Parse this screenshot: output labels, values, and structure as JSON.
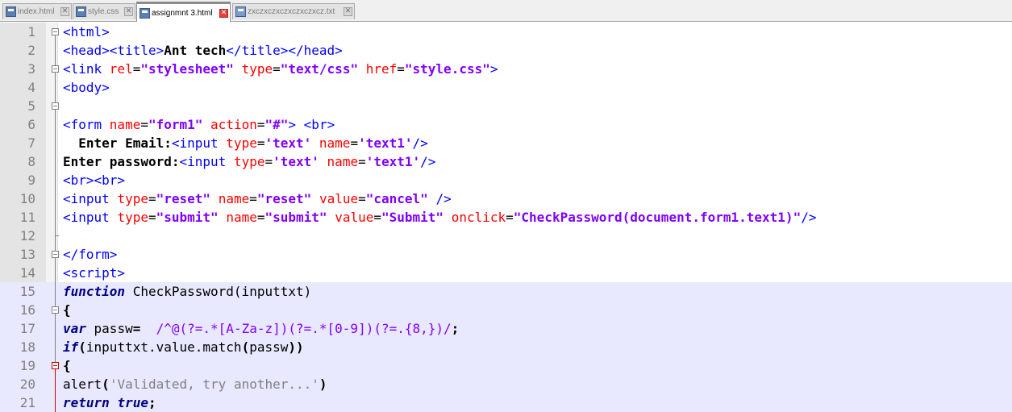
{
  "tabs": [
    {
      "label": "index.html",
      "icon": "html-file-icon",
      "active": false
    },
    {
      "label": "style.css",
      "icon": "css-file-icon",
      "active": false
    },
    {
      "label": "assignmnt 3.html",
      "icon": "html-file-icon",
      "active": true
    },
    {
      "label": "zxczxczxczxczxczxcz.txt",
      "icon": "txt-file-icon",
      "active": false
    }
  ],
  "close_glyph": "✕",
  "colors": {
    "tag": "#0000ff",
    "attribute": "#ff0000",
    "attribute_value": "#8000ff",
    "keyword": "#000080",
    "string": "#808080",
    "line_highlight": "#e8e8ff",
    "active_tab_accent": "#f5a623"
  },
  "lines": [
    {
      "num": "1",
      "hl": false,
      "tokens": [
        {
          "c": "t",
          "x": "<html>"
        }
      ]
    },
    {
      "num": "2",
      "hl": false,
      "tokens": [
        {
          "c": "t",
          "x": "<head><title>"
        },
        {
          "c": "b",
          "x": "Ant tech"
        },
        {
          "c": "t",
          "x": "</title></head>"
        }
      ]
    },
    {
      "num": "3",
      "hl": false,
      "tokens": [
        {
          "c": "t",
          "x": "<link "
        },
        {
          "c": "a",
          "x": "rel"
        },
        {
          "c": "",
          "x": "="
        },
        {
          "c": "v",
          "x": "\"stylesheet\""
        },
        {
          "c": "",
          "x": " "
        },
        {
          "c": "a",
          "x": "type"
        },
        {
          "c": "",
          "x": "="
        },
        {
          "c": "v",
          "x": "\"text/css\""
        },
        {
          "c": "",
          "x": " "
        },
        {
          "c": "a",
          "x": "href"
        },
        {
          "c": "",
          "x": "="
        },
        {
          "c": "v",
          "x": "\"style.css\""
        },
        {
          "c": "t",
          "x": ">"
        }
      ]
    },
    {
      "num": "4",
      "hl": false,
      "tokens": [
        {
          "c": "t",
          "x": "<body>"
        }
      ]
    },
    {
      "num": "5",
      "hl": false,
      "tokens": []
    },
    {
      "num": "6",
      "hl": false,
      "tokens": [
        {
          "c": "t",
          "x": "<form "
        },
        {
          "c": "a",
          "x": "name"
        },
        {
          "c": "",
          "x": "="
        },
        {
          "c": "v",
          "x": "\"form1\""
        },
        {
          "c": "",
          "x": " "
        },
        {
          "c": "a",
          "x": "action"
        },
        {
          "c": "",
          "x": "="
        },
        {
          "c": "v",
          "x": "\"#\""
        },
        {
          "c": "t",
          "x": ">"
        },
        {
          "c": "",
          "x": " "
        },
        {
          "c": "t",
          "x": "<br>"
        }
      ]
    },
    {
      "num": "7",
      "hl": false,
      "tokens": [
        {
          "c": "b",
          "x": "  Enter Email:"
        },
        {
          "c": "t",
          "x": "<input "
        },
        {
          "c": "a",
          "x": "type"
        },
        {
          "c": "",
          "x": "="
        },
        {
          "c": "v",
          "x": "'text'"
        },
        {
          "c": "",
          "x": " "
        },
        {
          "c": "a",
          "x": "name"
        },
        {
          "c": "",
          "x": "="
        },
        {
          "c": "v",
          "x": "'text1'"
        },
        {
          "c": "t",
          "x": "/>"
        }
      ]
    },
    {
      "num": "8",
      "hl": false,
      "tokens": [
        {
          "c": "b",
          "x": "Enter password:"
        },
        {
          "c": "t",
          "x": "<input "
        },
        {
          "c": "a",
          "x": "type"
        },
        {
          "c": "",
          "x": "="
        },
        {
          "c": "v",
          "x": "'text'"
        },
        {
          "c": "",
          "x": " "
        },
        {
          "c": "a",
          "x": "name"
        },
        {
          "c": "",
          "x": "="
        },
        {
          "c": "v",
          "x": "'text1'"
        },
        {
          "c": "t",
          "x": "/>"
        }
      ]
    },
    {
      "num": "9",
      "hl": false,
      "tokens": [
        {
          "c": "t",
          "x": "<br><br>"
        }
      ]
    },
    {
      "num": "10",
      "hl": false,
      "tokens": [
        {
          "c": "t",
          "x": "<input "
        },
        {
          "c": "a",
          "x": "type"
        },
        {
          "c": "",
          "x": "="
        },
        {
          "c": "v",
          "x": "\"reset\""
        },
        {
          "c": "",
          "x": " "
        },
        {
          "c": "a",
          "x": "name"
        },
        {
          "c": "",
          "x": "="
        },
        {
          "c": "v",
          "x": "\"reset\""
        },
        {
          "c": "",
          "x": " "
        },
        {
          "c": "a",
          "x": "value"
        },
        {
          "c": "",
          "x": "="
        },
        {
          "c": "v",
          "x": "\"cancel\""
        },
        {
          "c": "",
          "x": " "
        },
        {
          "c": "t",
          "x": "/>"
        }
      ]
    },
    {
      "num": "11",
      "hl": false,
      "tokens": [
        {
          "c": "t",
          "x": "<input "
        },
        {
          "c": "a",
          "x": "type"
        },
        {
          "c": "",
          "x": "="
        },
        {
          "c": "v",
          "x": "\"submit\""
        },
        {
          "c": "",
          "x": " "
        },
        {
          "c": "a",
          "x": "name"
        },
        {
          "c": "",
          "x": "="
        },
        {
          "c": "v",
          "x": "\"submit\""
        },
        {
          "c": "",
          "x": " "
        },
        {
          "c": "a",
          "x": "value"
        },
        {
          "c": "",
          "x": "="
        },
        {
          "c": "v",
          "x": "\"Submit\""
        },
        {
          "c": "",
          "x": " "
        },
        {
          "c": "a",
          "x": "onclick"
        },
        {
          "c": "",
          "x": "="
        },
        {
          "c": "v",
          "x": "\"CheckPassword(document.form1.text1)\""
        },
        {
          "c": "t",
          "x": "/>"
        }
      ]
    },
    {
      "num": "12",
      "hl": false,
      "tokens": []
    },
    {
      "num": "13",
      "hl": false,
      "tokens": [
        {
          "c": "t",
          "x": "</form>"
        }
      ]
    },
    {
      "num": "14",
      "hl": false,
      "tokens": [
        {
          "c": "t",
          "x": "<script>"
        }
      ]
    },
    {
      "num": "15",
      "hl": true,
      "tokens": [
        {
          "c": "kw",
          "x": "function"
        },
        {
          "c": "",
          "x": " CheckPassword(inputtxt)"
        }
      ]
    },
    {
      "num": "16",
      "hl": true,
      "tokens": [
        {
          "c": "b",
          "x": "{"
        }
      ]
    },
    {
      "num": "17",
      "hl": true,
      "tokens": [
        {
          "c": "kw",
          "x": "var"
        },
        {
          "c": "",
          "x": " passw"
        },
        {
          "c": "b",
          "x": "="
        },
        {
          "c": "",
          "x": "  "
        },
        {
          "c": "rx",
          "x": "/^@(?=.*[A-Za-z])(?=.*[0-9])(?=.{8,})/"
        },
        {
          "c": "b",
          "x": ";"
        }
      ]
    },
    {
      "num": "18",
      "hl": true,
      "tokens": [
        {
          "c": "kw",
          "x": "if"
        },
        {
          "c": "b",
          "x": "("
        },
        {
          "c": "",
          "x": "inputtxt.value.match"
        },
        {
          "c": "b",
          "x": "("
        },
        {
          "c": "",
          "x": "passw"
        },
        {
          "c": "b",
          "x": "))"
        }
      ]
    },
    {
      "num": "19",
      "hl": true,
      "tokens": [
        {
          "c": "b",
          "x": "{"
        }
      ]
    },
    {
      "num": "20",
      "hl": true,
      "tokens": [
        {
          "c": "",
          "x": "alert"
        },
        {
          "c": "b",
          "x": "("
        },
        {
          "c": "str",
          "x": "'Validated, try another...'"
        },
        {
          "c": "b",
          "x": ")"
        }
      ]
    },
    {
      "num": "21",
      "hl": true,
      "tokens": [
        {
          "c": "kw",
          "x": "return"
        },
        {
          "c": "",
          "x": " "
        },
        {
          "c": "kw",
          "x": "true"
        },
        {
          "c": "b",
          "x": ";"
        }
      ]
    }
  ]
}
